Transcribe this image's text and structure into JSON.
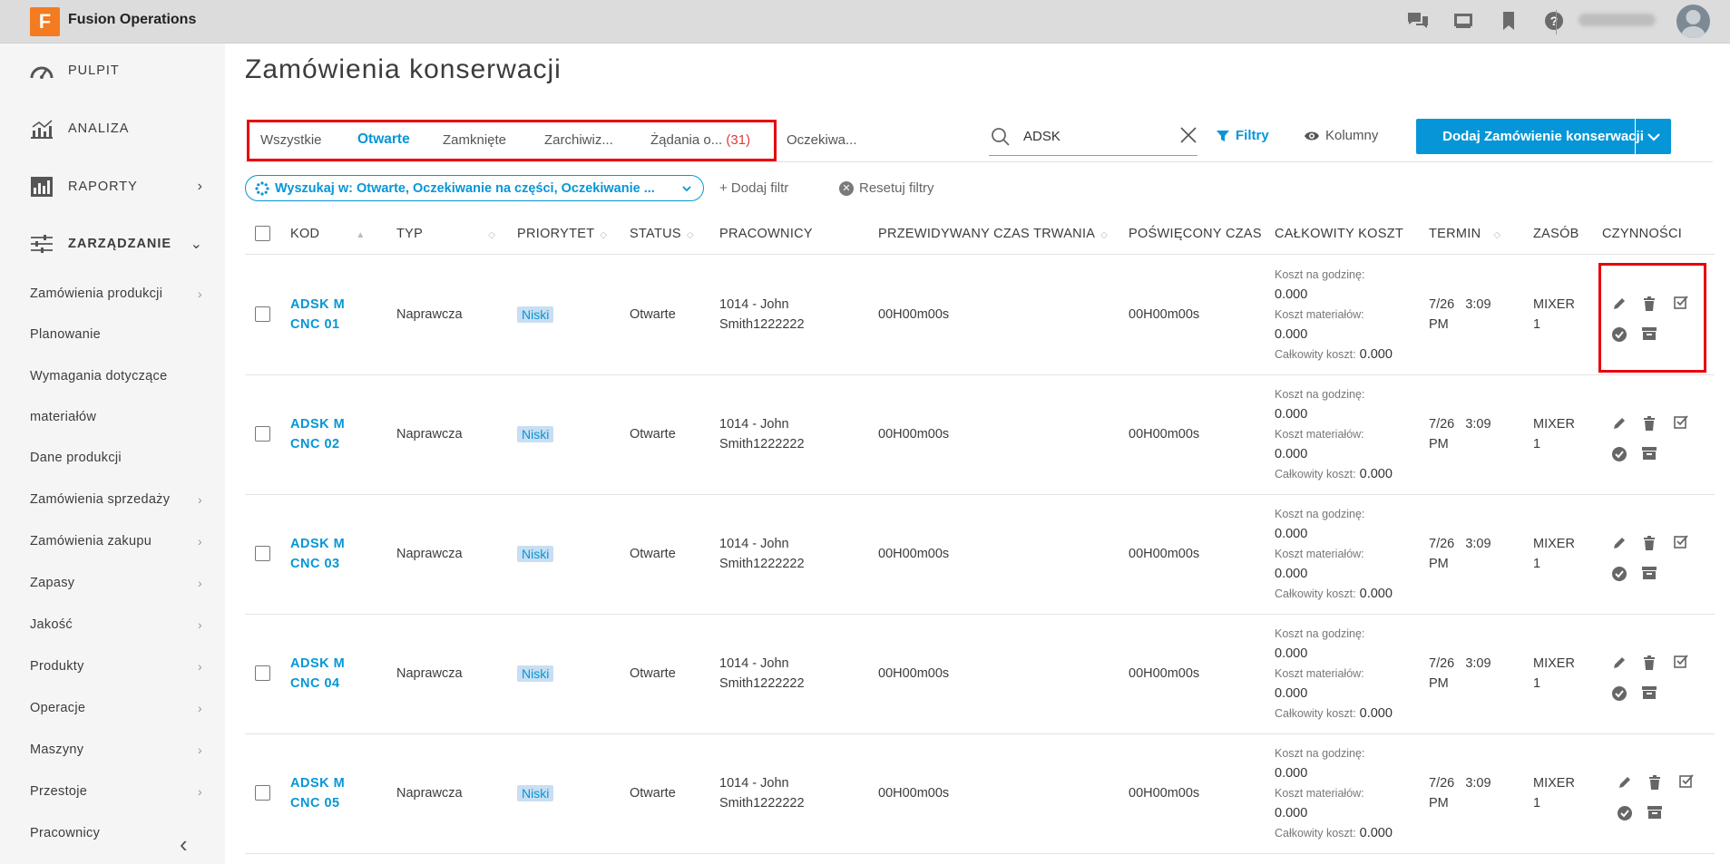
{
  "app": {
    "logo_letter": "F",
    "name": "Fusion Operations",
    "user_name": "Wolontariusz"
  },
  "sidebar": {
    "main": [
      {
        "label": "PULPIT",
        "icon": "gauge-icon"
      },
      {
        "label": "ANALIZA",
        "icon": "chart-icon"
      },
      {
        "label": "RAPORTY",
        "icon": "report-icon"
      },
      {
        "label": "ZARZĄDZANIE",
        "icon": "sliders-icon"
      }
    ],
    "sub": [
      "Zamówienia produkcji",
      "Planowanie",
      "Wymagania dotyczące",
      "materiałów",
      "Dane produkcji",
      "Zamówienia sprzedaży",
      "Zamówienia zakupu",
      "Zapasy",
      "Jakość",
      "Produkty",
      "Operacje",
      "Maszyny",
      "Przestoje",
      "Pracownicy"
    ]
  },
  "page": {
    "title": "Zamówienia konserwacji"
  },
  "tabs": {
    "all": "Wszystkie",
    "open": "Otwarte",
    "closed": "Zamknięte",
    "archived": "Zarchiwiz...",
    "requests": "Żądania o...",
    "requests_count": "(31)",
    "waiting": "Oczekiwa..."
  },
  "search": {
    "value": "ADSK"
  },
  "toolbar": {
    "filters": "Filtry",
    "columns": "Kolumny",
    "add": "Dodaj Zamówienie konserwacji"
  },
  "filters": {
    "chip": "Wyszukaj w: Otwarte, Oczekiwanie na części, Oczekiwanie ...",
    "add": "+ Dodaj filtr",
    "reset": "Resetuj filtry"
  },
  "table": {
    "headers": {
      "code": "KOD",
      "type": "TYP",
      "priority": "PRIORYTET",
      "status": "STATUS",
      "workers": "PRACOWNICY",
      "est_time": "PRZEWIDYWANY CZAS TRWANIA",
      "spent_time": "POŚWIĘCONY CZAS",
      "total_cost": "CAŁKOWITY KOSZT",
      "due": "TERMIN",
      "resource": "ZASÓB",
      "actions": "CZYNNOŚCI"
    },
    "cost_labels": {
      "hour": "Koszt na godzinę:",
      "materials": "Koszt materiałów:",
      "total": "Całkowity koszt:"
    },
    "rows": [
      {
        "code1": "ADSK M",
        "code2": "CNC 01",
        "type": "Naprawcza",
        "priority": "Niski",
        "status": "Otwarte",
        "worker1": "1014 - John",
        "worker2": "Smith1222222",
        "est": "00H00m00s",
        "spent": "00H00m00s",
        "hour_cost": "0.000",
        "mat_cost": "0.000",
        "total_cost": "0.000",
        "due1": "7/26",
        "due2": "3:09",
        "due3": "PM",
        "res1": "MIXER",
        "res2": "1"
      },
      {
        "code1": "ADSK M",
        "code2": "CNC 02",
        "type": "Naprawcza",
        "priority": "Niski",
        "status": "Otwarte",
        "worker1": "1014 - John",
        "worker2": "Smith1222222",
        "est": "00H00m00s",
        "spent": "00H00m00s",
        "hour_cost": "0.000",
        "mat_cost": "0.000",
        "total_cost": "0.000",
        "due1": "7/26",
        "due2": "3:09",
        "due3": "PM",
        "res1": "MIXER",
        "res2": "1"
      },
      {
        "code1": "ADSK M",
        "code2": "CNC 03",
        "type": "Naprawcza",
        "priority": "Niski",
        "status": "Otwarte",
        "worker1": "1014 - John",
        "worker2": "Smith1222222",
        "est": "00H00m00s",
        "spent": "00H00m00s",
        "hour_cost": "0.000",
        "mat_cost": "0.000",
        "total_cost": "0.000",
        "due1": "7/26",
        "due2": "3:09",
        "due3": "PM",
        "res1": "MIXER",
        "res2": "1"
      },
      {
        "code1": "ADSK M",
        "code2": "CNC 04",
        "type": "Naprawcza",
        "priority": "Niski",
        "status": "Otwarte",
        "worker1": "1014 - John",
        "worker2": "Smith1222222",
        "est": "00H00m00s",
        "spent": "00H00m00s",
        "hour_cost": "0.000",
        "mat_cost": "0.000",
        "total_cost": "0.000",
        "due1": "7/26",
        "due2": "3:09",
        "due3": "PM",
        "res1": "MIXER",
        "res2": "1"
      },
      {
        "code1": "ADSK M",
        "code2": "CNC 05",
        "type": "Naprawcza",
        "priority": "Niski",
        "status": "Otwarte",
        "worker1": "1014 - John",
        "worker2": "Smith1222222",
        "est": "00H00m00s",
        "spent": "00H00m00s",
        "hour_cost": "0.000",
        "mat_cost": "0.000",
        "total_cost": "0.000",
        "due1": "7/26",
        "due2": "3:09",
        "due3": "PM",
        "res1": "MIXER",
        "res2": "1"
      }
    ]
  },
  "colors": {
    "accent": "#0696d7",
    "highlight": "#e8000b",
    "logo": "#f47b20"
  }
}
